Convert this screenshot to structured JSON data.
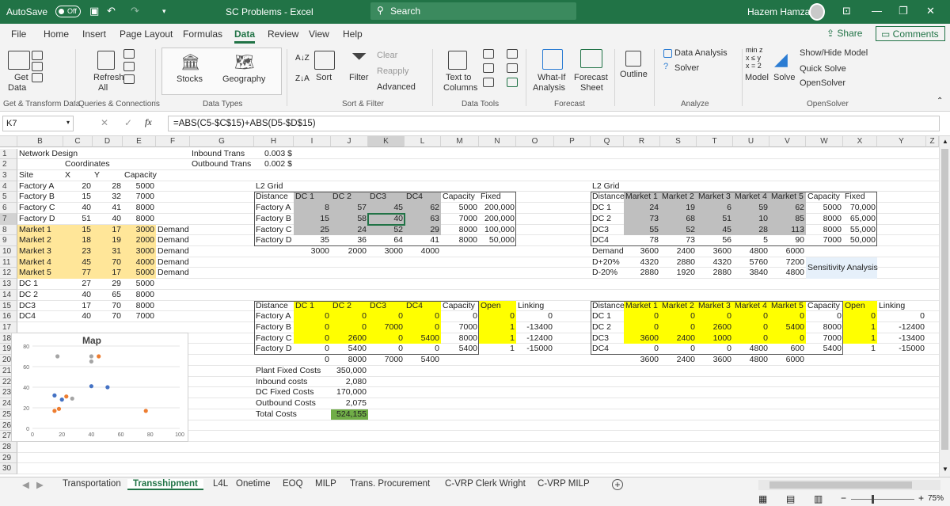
{
  "titlebar": {
    "autosave": "AutoSave",
    "autosave_state": "Off",
    "doc_title": "SC Problems  -  Excel",
    "search": "Search",
    "user": "Hazem Hamza"
  },
  "tabs": [
    "File",
    "Home",
    "Insert",
    "Page Layout",
    "Formulas",
    "Data",
    "Review",
    "View",
    "Help"
  ],
  "ribbon": {
    "share": "Share",
    "comments": "Comments",
    "get_data": "Get",
    "get_data2": "Data",
    "refresh_all": "Refresh",
    "refresh_all2": "All",
    "stocks": "Stocks",
    "geography": "Geography",
    "sort": "Sort",
    "filter": "Filter",
    "clear": "Clear",
    "reapply": "Reapply",
    "advanced": "Advanced",
    "text_to_columns": "Text to",
    "text_to_columns2": "Columns",
    "what_if": "What-If",
    "what_if2": "Analysis",
    "forecast": "Forecast",
    "forecast2": "Sheet",
    "outline": "Outline",
    "data_analysis": "Data Analysis",
    "solver": "Solver",
    "model": "Model",
    "solve": "Solve",
    "show_hide": "Show/Hide Model",
    "quick_solve": "Quick Solve",
    "opensolver": "OpenSolver",
    "minz": "min z",
    "xsy": "x ≤ y",
    "x2": "x = 2",
    "groups": {
      "gt": "Get & Transform Data",
      "qc": "Queries & Connections",
      "dt": "Data Types",
      "sf": "Sort & Filter",
      "dtools": "Data Tools",
      "fc": "Forecast",
      "an": "Analyze",
      "os": "OpenSolver"
    }
  },
  "formula_bar": {
    "name_box": "K7",
    "fx": "fx",
    "formula": "=ABS(C5-$C$15)+ABS(D5-$D$15)"
  },
  "columns": [
    "B",
    "C",
    "D",
    "E",
    "F",
    "G",
    "H",
    "I",
    "J",
    "K",
    "L",
    "M",
    "N",
    "O",
    "P",
    "Q",
    "R",
    "S",
    "T",
    "U",
    "V",
    "W",
    "X",
    "Y",
    "Z"
  ],
  "rows": [
    "1",
    "2",
    "3",
    "4",
    "5",
    "6",
    "7",
    "8",
    "9",
    "10",
    "11",
    "12",
    "13",
    "14",
    "15",
    "16",
    "17",
    "18",
    "19",
    "20",
    "21",
    "22",
    "23",
    "24",
    "25",
    "26",
    "27",
    "28",
    "29",
    "30"
  ],
  "cells": {
    "b1": "Network Design",
    "c2": "Coordinates",
    "b3": "Site",
    "c3": "X",
    "d3": "Y",
    "e2": "Capacity",
    "sites": [
      {
        "name": "Factory A",
        "x": "20",
        "y": "28",
        "cap": "5000",
        "d": ""
      },
      {
        "name": "Factory B",
        "x": "15",
        "y": "32",
        "cap": "7000",
        "d": ""
      },
      {
        "name": "Factory C",
        "x": "40",
        "y": "41",
        "cap": "8000",
        "d": ""
      },
      {
        "name": "Factory D",
        "x": "51",
        "y": "40",
        "cap": "8000",
        "d": ""
      },
      {
        "name": "Market 1",
        "x": "15",
        "y": "17",
        "cap": "3000",
        "d": "Demand"
      },
      {
        "name": "Market 2",
        "x": "18",
        "y": "19",
        "cap": "2000",
        "d": "Demand"
      },
      {
        "name": "Market 3",
        "x": "23",
        "y": "31",
        "cap": "3000",
        "d": "Demand"
      },
      {
        "name": "Market 4",
        "x": "45",
        "y": "70",
        "cap": "4000",
        "d": "Demand"
      },
      {
        "name": "Market 5",
        "x": "77",
        "y": "17",
        "cap": "5000",
        "d": "Demand"
      },
      {
        "name": "DC 1",
        "x": "27",
        "y": "29",
        "cap": "5000",
        "d": ""
      },
      {
        "name": "DC 2",
        "x": "40",
        "y": "65",
        "cap": "8000",
        "d": ""
      },
      {
        "name": "DC3",
        "x": "17",
        "y": "70",
        "cap": "8000",
        "d": ""
      },
      {
        "name": "DC4",
        "x": "40",
        "y": "70",
        "cap": "7000",
        "d": ""
      }
    ],
    "g1": "Inbound Trans",
    "g2": "Outbound Trans",
    "h1": "0.003 $",
    "h2": "0.002 $",
    "l2grid": "L2 Grid",
    "dist": "Distance",
    "l2hdr": [
      "DC 1",
      "DC 2",
      "DC3",
      "DC4"
    ],
    "capacity": "Capacity",
    "fixed": "Fixed",
    "l2rows": [
      {
        "n": "Factory A",
        "v": [
          "8",
          "57",
          "45",
          "62"
        ],
        "cap": "5000",
        "fx": "200,000"
      },
      {
        "n": "Factory B",
        "v": [
          "15",
          "58",
          "40",
          "63"
        ],
        "cap": "7000",
        "fx": "200,000"
      },
      {
        "n": "Factory C",
        "v": [
          "25",
          "24",
          "52",
          "29"
        ],
        "cap": "8000",
        "fx": "100,000"
      },
      {
        "n": "Factory D",
        "v": [
          "35",
          "36",
          "64",
          "41"
        ],
        "cap": "8000",
        "fx": "50,000"
      }
    ],
    "l2tot": [
      "3000",
      "2000",
      "3000",
      "4000"
    ],
    "rgrid": "L2 Grid",
    "rhdr": [
      "Market 1",
      "Market 2",
      "Market 3",
      "Market 4",
      "Market 5"
    ],
    "rrows": [
      {
        "n": "DC 1",
        "v": [
          "24",
          "19",
          "6",
          "59",
          "62"
        ],
        "cap": "5000",
        "fx": "70,000"
      },
      {
        "n": "DC 2",
        "v": [
          "73",
          "68",
          "51",
          "10",
          "85"
        ],
        "cap": "8000",
        "fx": "65,000"
      },
      {
        "n": "DC3",
        "v": [
          "55",
          "52",
          "45",
          "28",
          "113"
        ],
        "cap": "8000",
        "fx": "55,000"
      },
      {
        "n": "DC4",
        "v": [
          "78",
          "73",
          "56",
          "5",
          "90"
        ],
        "cap": "7000",
        "fx": "50,000"
      }
    ],
    "demand": "Demand",
    "dvals": [
      "3600",
      "2400",
      "3600",
      "4800",
      "6000"
    ],
    "dplus": "D+20%",
    "dpvals": [
      "4320",
      "2880",
      "4320",
      "5760",
      "7200"
    ],
    "dminus": "D-20%",
    "dmvals": [
      "2880",
      "1920",
      "2880",
      "3840",
      "4800"
    ],
    "sens": "Sensitivity Analysis",
    "open": "Open",
    "linking": "Linking",
    "frows": [
      {
        "n": "Factory A",
        "v": [
          "0",
          "0",
          "0",
          "0"
        ],
        "cap": "0",
        "open": "0",
        "link": "0"
      },
      {
        "n": "Factory B",
        "v": [
          "0",
          "0",
          "7000",
          "0"
        ],
        "cap": "7000",
        "open": "1",
        "link": "-13400"
      },
      {
        "n": "Factory C",
        "v": [
          "0",
          "2600",
          "0",
          "5400"
        ],
        "cap": "8000",
        "open": "1",
        "link": "-12400"
      },
      {
        "n": "Factory D",
        "v": [
          "0",
          "5400",
          "0",
          "0"
        ],
        "cap": "5400",
        "open": "1",
        "link": "-15000"
      }
    ],
    "ftot": [
      "0",
      "8000",
      "7000",
      "5400"
    ],
    "drows": [
      {
        "n": "DC 1",
        "v": [
          "0",
          "0",
          "0",
          "0",
          "0"
        ],
        "cap": "0",
        "open": "0",
        "link": "0"
      },
      {
        "n": "DC 2",
        "v": [
          "0",
          "0",
          "2600",
          "0",
          "5400"
        ],
        "cap": "8000",
        "open": "1",
        "link": "-12400"
      },
      {
        "n": "DC3",
        "v": [
          "3600",
          "2400",
          "1000",
          "0",
          "0"
        ],
        "cap": "7000",
        "open": "1",
        "link": "-13400"
      },
      {
        "n": "DC4",
        "v": [
          "0",
          "0",
          "0",
          "4800",
          "600"
        ],
        "cap": "5400",
        "open": "1",
        "link": "-15000"
      }
    ],
    "dtot": [
      "3600",
      "2400",
      "3600",
      "4800",
      "6000"
    ],
    "costs": [
      {
        "n": "Plant Fixed Costs",
        "v": "350,000"
      },
      {
        "n": "Inbound costs",
        "v": "2,080"
      },
      {
        "n": "DC Fixed Costs",
        "v": "170,000"
      },
      {
        "n": "Outbound Costs",
        "v": "2,075"
      },
      {
        "n": "Total Costs",
        "v": "524,155"
      }
    ]
  },
  "chart_data": {
    "type": "scatter",
    "title": "Map",
    "xlim": [
      0,
      100
    ],
    "ylim": [
      0,
      80
    ],
    "xticks": [
      "0",
      "20",
      "40",
      "60",
      "80",
      "100"
    ],
    "yticks": [
      "0",
      "20",
      "40",
      "60",
      "80"
    ],
    "series": [
      {
        "color": "#4472c4",
        "x": [
          20,
          15,
          40,
          51
        ],
        "y": [
          28,
          32,
          41,
          40
        ]
      },
      {
        "color": "#ed7d31",
        "x": [
          15,
          18,
          23,
          45,
          77
        ],
        "y": [
          17,
          19,
          31,
          70,
          17
        ]
      },
      {
        "color": "#a5a5a5",
        "x": [
          27,
          40,
          17,
          40
        ],
        "y": [
          29,
          65,
          70,
          70
        ]
      }
    ]
  },
  "sheets": [
    "Transportation",
    "Transshipment",
    "L4L",
    "Onetime",
    "EOQ",
    "MILP",
    "Trans. Procurement",
    "C-VRP Clerk Wright",
    "C-VRP MILP"
  ],
  "status": {
    "zoom": "75%"
  }
}
